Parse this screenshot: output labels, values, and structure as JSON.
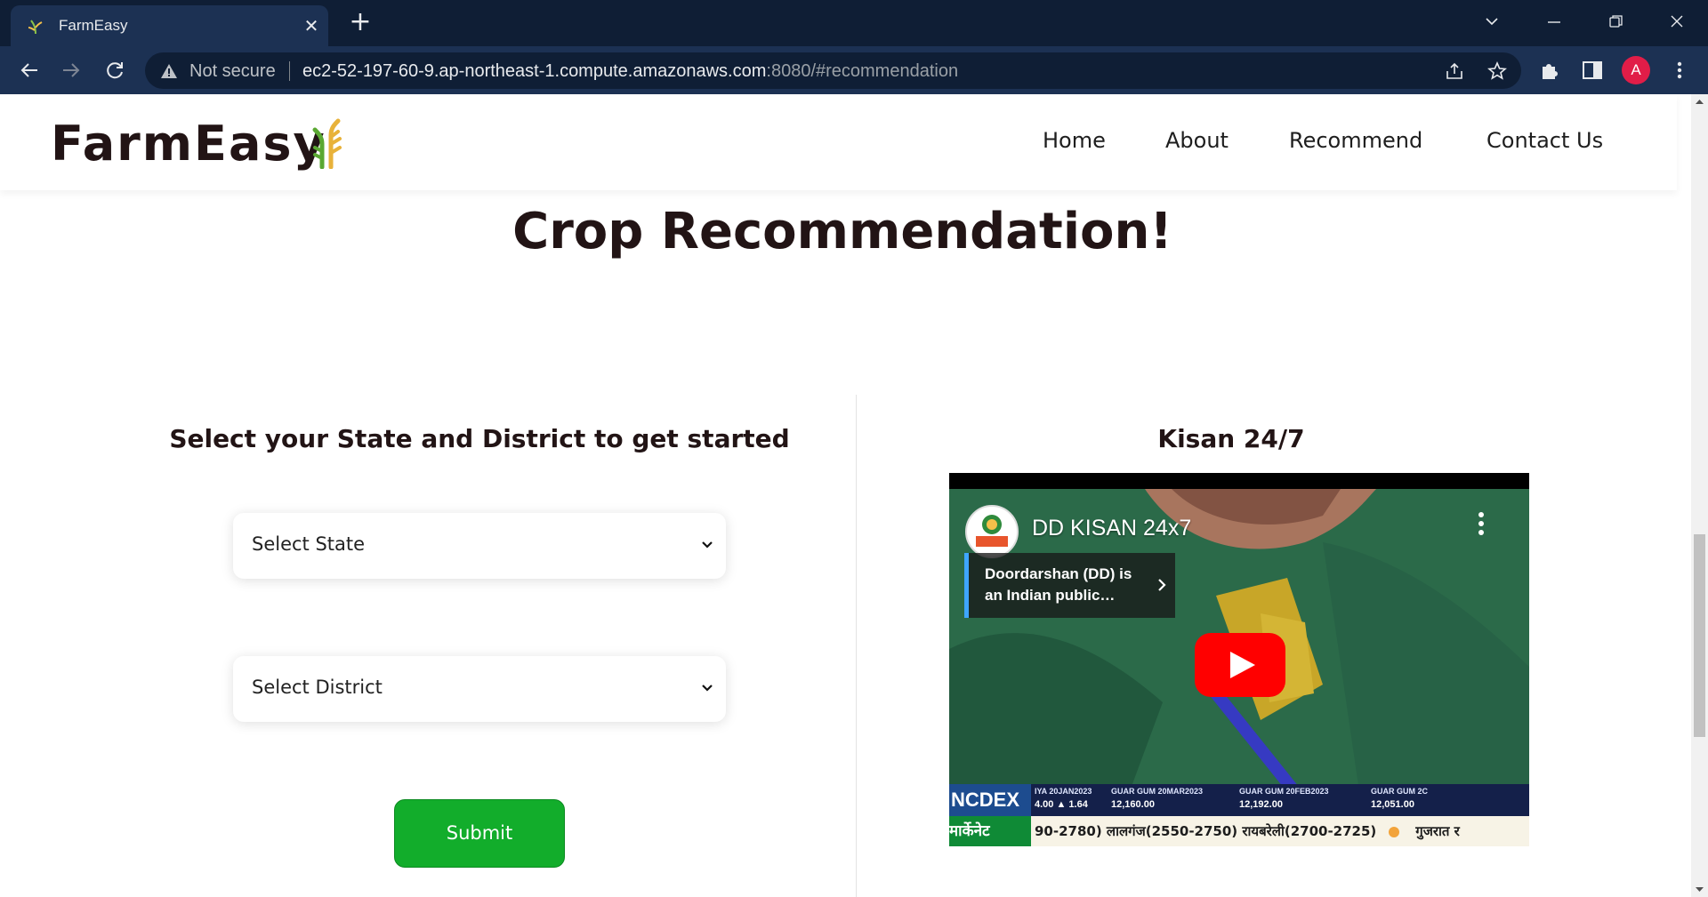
{
  "browser": {
    "tab_title": "FarmEasy",
    "security_label": "Not secure",
    "url_host": "ec2-52-197-60-9.ap-northeast-1.compute.amazonaws.com",
    "url_rest": ":8080/#recommendation",
    "profile_initial": "A"
  },
  "site": {
    "brand": "FarmEasy",
    "nav": [
      {
        "label": "Home"
      },
      {
        "label": "About"
      },
      {
        "label": "Recommend"
      },
      {
        "label": "Contact Us"
      }
    ]
  },
  "page": {
    "title": "Crop Recommendation!",
    "form": {
      "heading": "Select your State and District to get started",
      "state_select": "Select State",
      "district_select": "Select District",
      "submit_label": "Submit"
    },
    "video": {
      "heading": "Kisan 24/7",
      "channel_name": "DD KISAN 24x7",
      "info_card_text": "Doordarshan (DD) is an Indian public…",
      "ticker_brand": "NCDEX",
      "ticker_items": [
        {
          "name": "IYA 20JAN2023",
          "value": "4.00  ▲ 1.64"
        },
        {
          "name": "GUAR GUM 20MAR2023",
          "value": "12,160.00"
        },
        {
          "name": "GUAR GUM 20FEB2023",
          "value": "12,192.00"
        },
        {
          "name": "GUAR GUM 2C",
          "value": "12,051.00"
        }
      ],
      "ticker_market": "मार्केनेट",
      "ticker_text": "90-2780) लालगंज(2550-2750) रायबरेली(2700-2725)",
      "ticker_text_2": "गुजरात र"
    }
  },
  "colors": {
    "brand_dark": "#221415",
    "submit_green": "#12ad2b",
    "chrome_dark": "#0f1e35",
    "chrome_toolbar": "#1c3153",
    "youtube_red": "#ff0000"
  }
}
